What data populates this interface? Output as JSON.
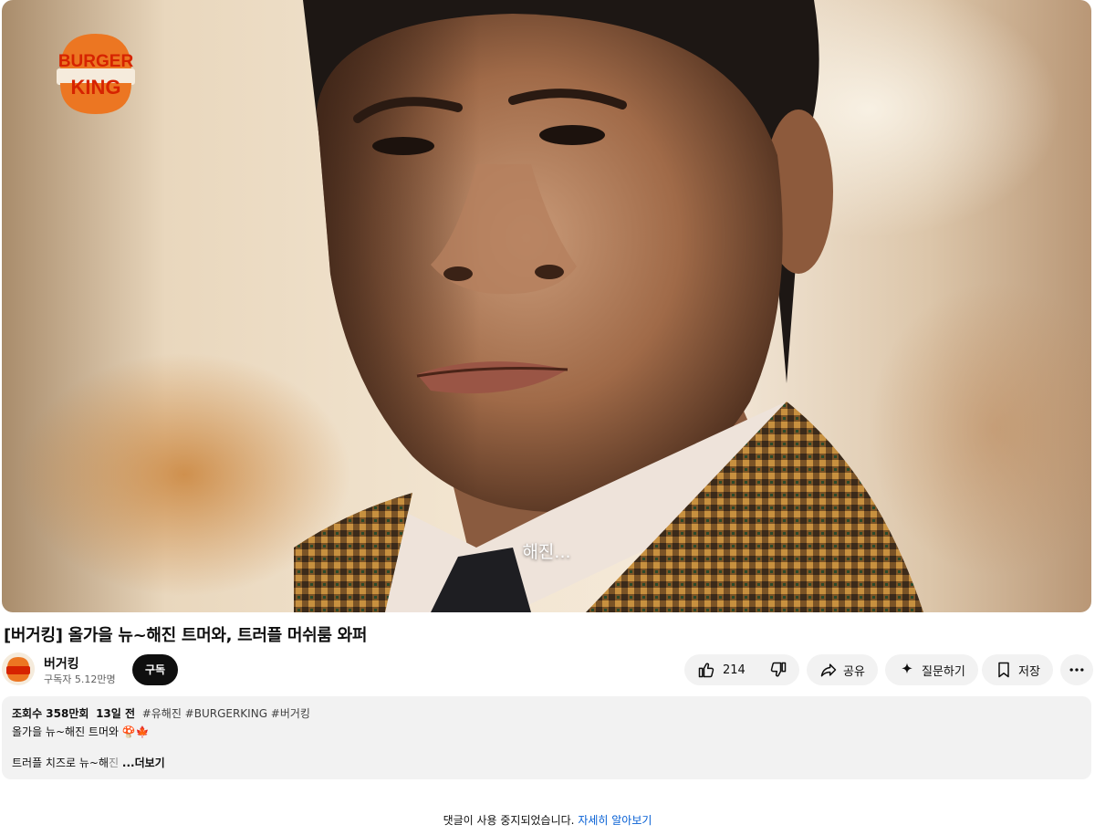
{
  "video": {
    "subtitle": "해진...",
    "brand_logo_lines": [
      "BURGER",
      "KING"
    ]
  },
  "title": "[버거킹] 올가을 뉴~해진 트머와, 트러플 머쉬룸 와퍼",
  "channel": {
    "name": "버거킹",
    "subscribers": "구독자 5.12만명",
    "subscribe_label": "구독"
  },
  "actions": {
    "like_count": "214",
    "share_label": "공유",
    "ask_label": "질문하기",
    "save_label": "저장"
  },
  "description": {
    "views": "조회수 358만회",
    "date": "13일 전",
    "hashtags": "#유해진 #BURGERKING #버거킹",
    "line1": "올가을 뉴~해진 트머와",
    "line1_emoji": "🍄🍁",
    "line2_text": "트러플 치즈로 뉴~해",
    "line2_fade": "진",
    "more_label": "...더보기"
  },
  "comments": {
    "disabled_text": "댓글이 사용 중지되었습니다.",
    "learn_more": "자세히 알아보기"
  },
  "colors": {
    "bk_orange": "#ec7622",
    "bk_red": "#d62300",
    "bk_bun": "#f5ebdc",
    "link_blue": "#065fd4"
  }
}
